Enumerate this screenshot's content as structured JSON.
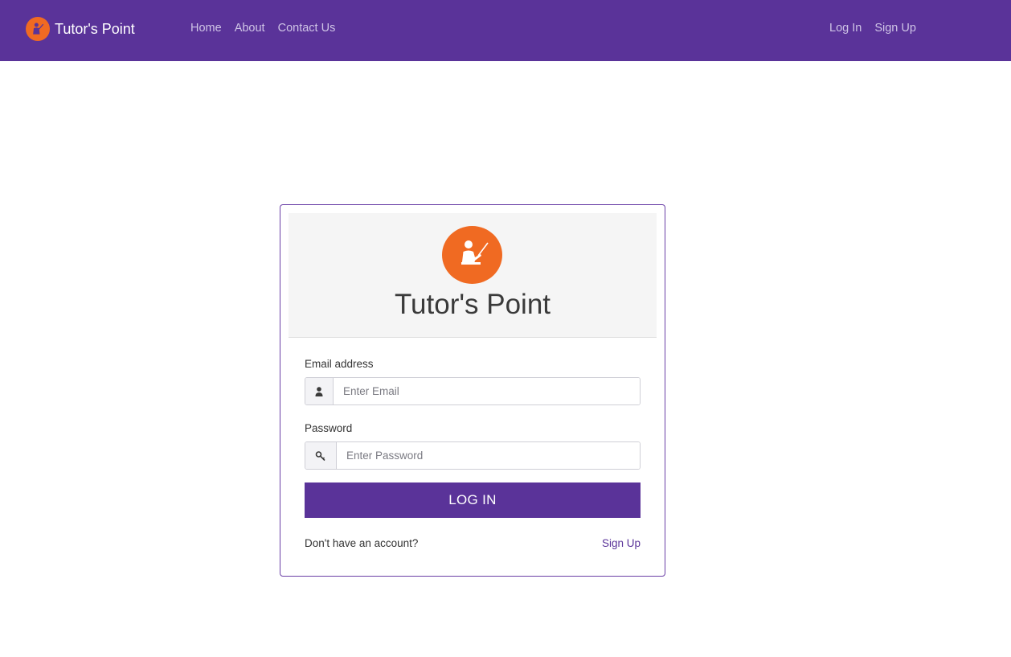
{
  "navbar": {
    "brand": "Tutor's Point",
    "links_left": [
      "Home",
      "About",
      "Contact Us"
    ],
    "links_right": [
      "Log In",
      "Sign Up"
    ]
  },
  "login_card": {
    "title": "Tutor's Point",
    "email_label": "Email address",
    "email_placeholder": "Enter Email",
    "email_value": "",
    "password_label": "Password",
    "password_placeholder": "Enter Password",
    "password_value": "",
    "submit_label": "LOG IN",
    "footer_text": "Don't have an account?",
    "footer_link": "Sign Up"
  },
  "icons": {
    "brand_logo": "teacher-icon",
    "card_logo": "teacher-icon",
    "email_addon": "user-icon",
    "password_addon": "key-icon"
  },
  "colors": {
    "primary": "#5a3399",
    "accent": "#f06a22",
    "nav_link": "#cfc4e6"
  }
}
